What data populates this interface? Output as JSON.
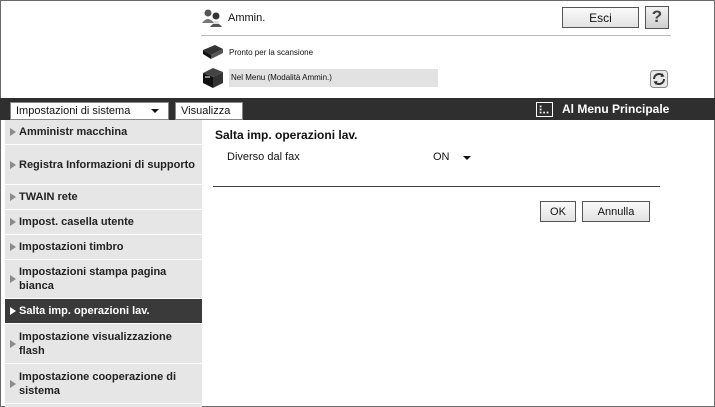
{
  "header": {
    "user_label": "Ammin.",
    "logout_label": "Esci",
    "help_label": "?",
    "status_ready": "Pronto per la scansione",
    "status_menu": "Nel Menu (Modalità Ammin.)"
  },
  "nav": {
    "section_select": "Impostazioni di sistema",
    "view_tab": "Visualizza",
    "main_menu": "Al Menu Principale"
  },
  "sidebar": {
    "items": [
      {
        "label": "Amministr macchina"
      },
      {
        "label": "Registra Informazioni di supporto"
      },
      {
        "label": "TWAIN rete"
      },
      {
        "label": "Impost. casella utente"
      },
      {
        "label": "Impostazioni timbro"
      },
      {
        "label": "Impostazioni stampa pagina bianca"
      },
      {
        "label": "Salta imp. operazioni lav."
      },
      {
        "label": "Impostazione visualizzazione flash"
      },
      {
        "label": "Impostazione cooperazione di sistema"
      }
    ],
    "active_index": 6
  },
  "content": {
    "title": "Salta imp. operazioni lav.",
    "field_label": "Diverso dal fax",
    "field_value": "ON",
    "ok_label": "OK",
    "cancel_label": "Annulla"
  }
}
